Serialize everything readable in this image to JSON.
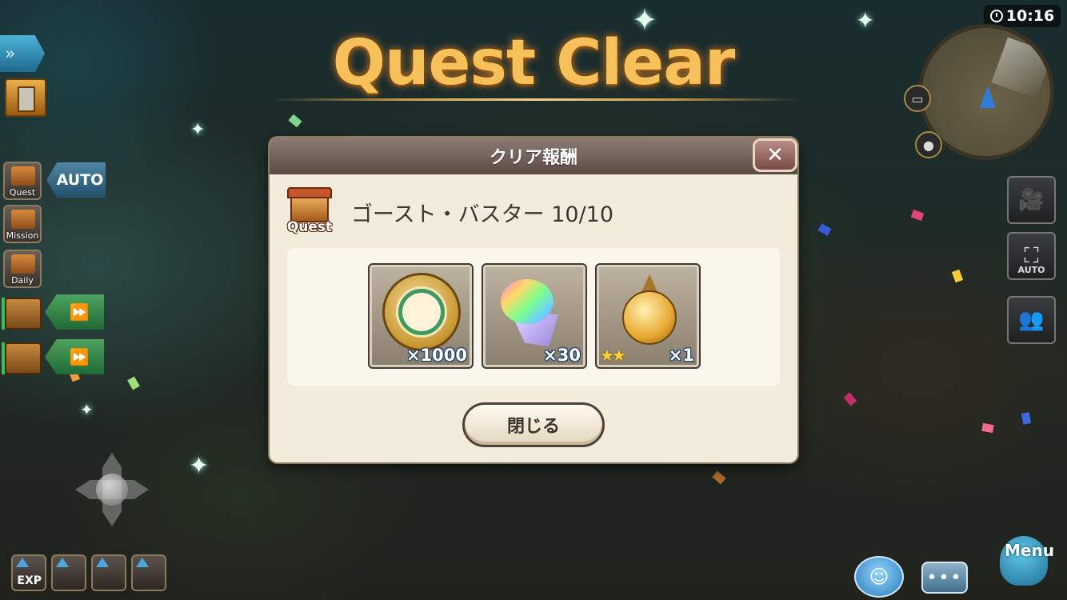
{
  "title": "Quest Clear",
  "clock": {
    "time": "10:16"
  },
  "hud_left": {
    "auto_label": "AUTO",
    "buttons": [
      {
        "label": "Quest"
      },
      {
        "label": "Mission"
      },
      {
        "label": "Daily"
      }
    ],
    "skill_buttons": [
      {
        "label": "EXP"
      }
    ]
  },
  "hud_right": {
    "auto_camera_label": "AUTO",
    "menu_label": "Menu"
  },
  "dialog": {
    "title": "クリア報酬",
    "quest_icon_label": "Quest",
    "quest_name": "ゴースト・バスター 10/10",
    "rewards": [
      {
        "icon": "medal-coin-icon",
        "quantity": "×1000"
      },
      {
        "icon": "rainbow-gem-icon",
        "quantity": "×30"
      },
      {
        "icon": "golden-orb-icon",
        "quantity": "×1",
        "stars": "★★"
      }
    ],
    "close_button_label": "閉じる"
  },
  "colors": {
    "title_gold": "#f6c15a",
    "dialog_bg": "#f3ecdc",
    "header_bg": "#6e5d58",
    "quantity_text": "#ffffff",
    "star": "#ffd23a"
  }
}
